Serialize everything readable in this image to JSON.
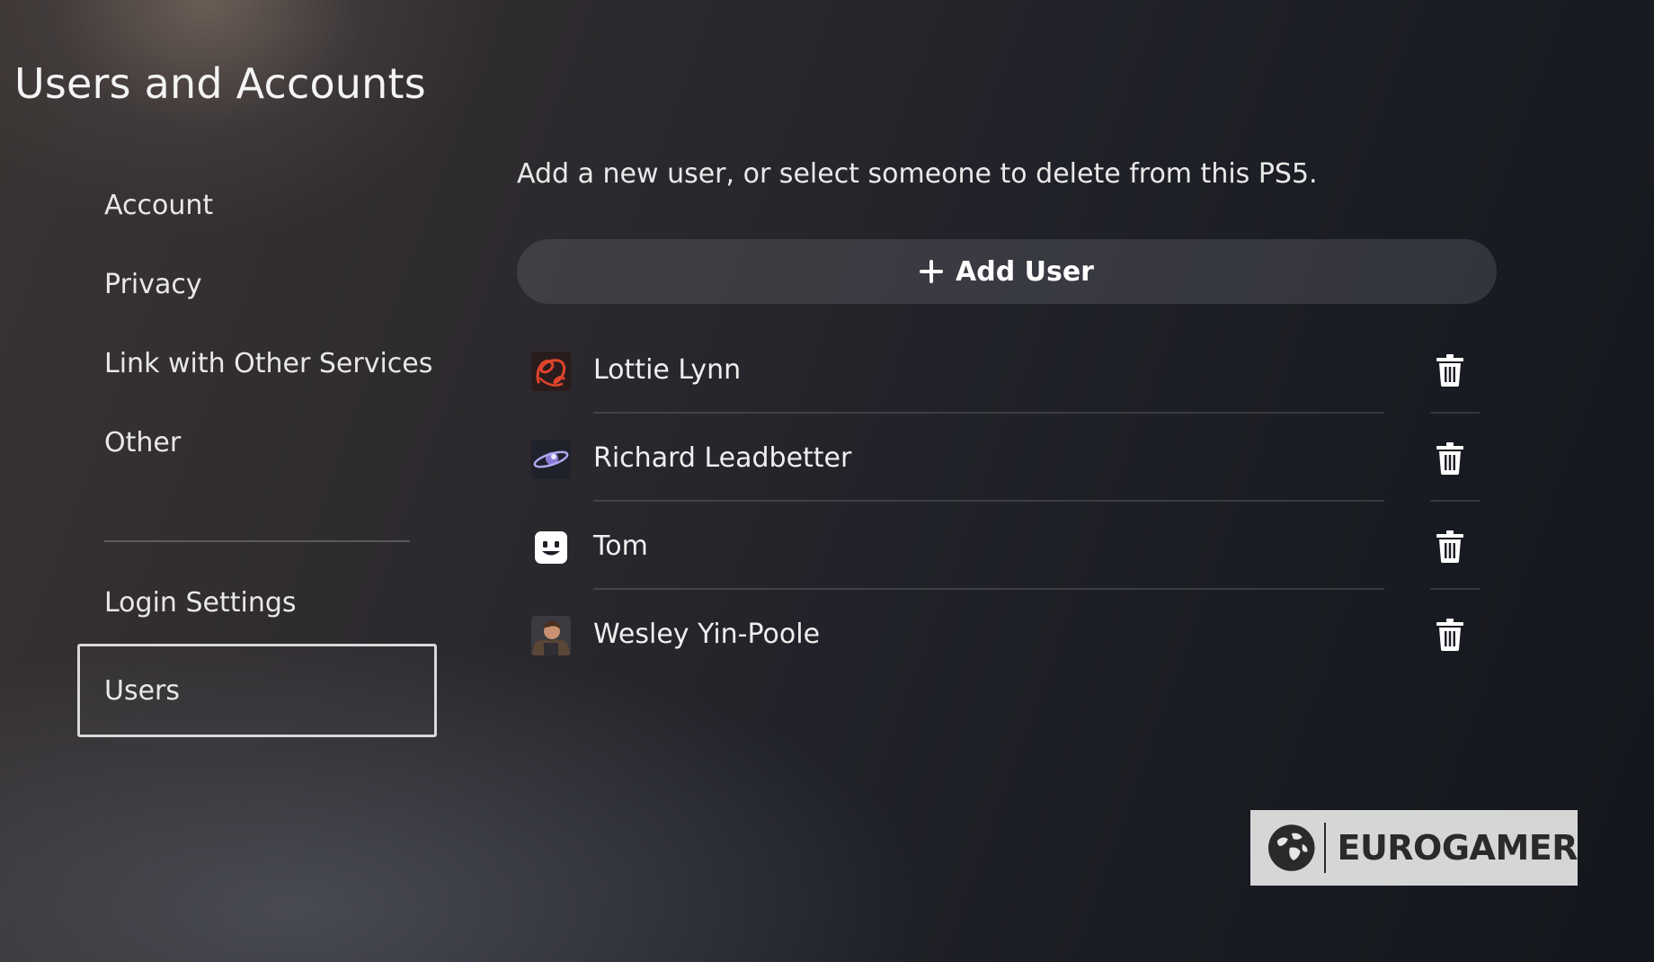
{
  "header": {
    "title": "Users and Accounts"
  },
  "sidebar": {
    "items": [
      {
        "label": "Account"
      },
      {
        "label": "Privacy"
      },
      {
        "label": "Link with Other Services"
      },
      {
        "label": "Other"
      },
      {
        "label": "Login Settings"
      },
      {
        "label": "Users",
        "selected": true
      }
    ]
  },
  "main": {
    "description": "Add a new user, or select someone to delete from this PS5.",
    "add_user_label": "Add User",
    "users": [
      {
        "name": "Lottie Lynn",
        "avatar": "red-line-art-avatar"
      },
      {
        "name": "Richard Leadbetter",
        "avatar": "ringed-planet-avatar"
      },
      {
        "name": "Tom",
        "avatar": "smiley-face-avatar"
      },
      {
        "name": "Wesley Yin-Poole",
        "avatar": "character-portrait-avatar"
      }
    ]
  },
  "watermark": {
    "text": "EUROGAMER",
    "icon": "globe-icon"
  },
  "colors": {
    "accent": "#ffffff",
    "text": "#f2f2f2",
    "button_bg": "#4a4a52",
    "lottie_avatar": "#e0442c"
  }
}
